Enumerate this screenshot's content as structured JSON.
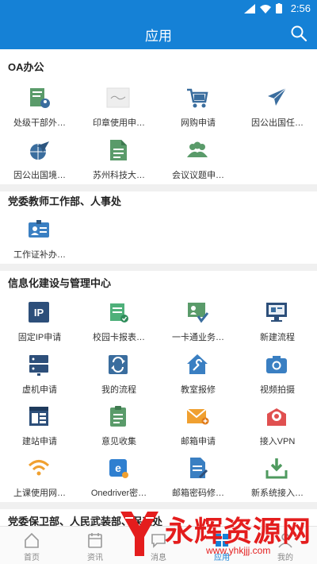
{
  "status": {
    "time": "2:56"
  },
  "header": {
    "title": "应用"
  },
  "sections": [
    {
      "title": "OA办公",
      "items": [
        {
          "label": "处级干部外…",
          "icon": "leader-leave-icon"
        },
        {
          "label": "印章使用申…",
          "icon": "seal-icon"
        },
        {
          "label": "网购申请",
          "icon": "cart-icon"
        },
        {
          "label": "因公出国任…",
          "icon": "airplane-icon"
        },
        {
          "label": "因公出国境…",
          "icon": "globe-plane-icon"
        },
        {
          "label": "苏州科技大…",
          "icon": "document-icon"
        },
        {
          "label": "会议议题申…",
          "icon": "meeting-people-icon"
        }
      ]
    },
    {
      "title": "党委教师工作部、人事处",
      "items": [
        {
          "label": "工作证补办…",
          "icon": "id-card-icon"
        }
      ]
    },
    {
      "title": "信息化建设与管理中心",
      "items": [
        {
          "label": "固定IP申请",
          "icon": "ip-icon",
          "glyph": "IP"
        },
        {
          "label": "校园卡报表…",
          "icon": "campus-card-icon"
        },
        {
          "label": "一卡通业务…",
          "icon": "card-business-icon"
        },
        {
          "label": "新建流程",
          "icon": "new-process-icon"
        },
        {
          "label": "虚机申请",
          "icon": "server-icon"
        },
        {
          "label": "我的流程",
          "icon": "my-process-icon"
        },
        {
          "label": "教室报修",
          "icon": "repair-icon"
        },
        {
          "label": "视频拍摄",
          "icon": "camera-icon"
        },
        {
          "label": "建站申请",
          "icon": "website-icon"
        },
        {
          "label": "意见收集",
          "icon": "clipboard-icon"
        },
        {
          "label": "邮箱申请",
          "icon": "mail-icon"
        },
        {
          "label": "接入VPN",
          "icon": "vpn-icon"
        },
        {
          "label": "上课使用网…",
          "icon": "wifi-icon"
        },
        {
          "label": "Onedriver密…",
          "icon": "onedrive-icon"
        },
        {
          "label": "邮箱密码修…",
          "icon": "mail-password-icon"
        },
        {
          "label": "新系统接入…",
          "icon": "download-icon"
        }
      ]
    },
    {
      "title": "党委保卫部、人民武装部、保卫处",
      "items": []
    }
  ],
  "nav": [
    {
      "label": "首页",
      "icon": "home-icon"
    },
    {
      "label": "资讯",
      "icon": "news-icon"
    },
    {
      "label": "消息",
      "icon": "message-icon"
    },
    {
      "label": "应用",
      "icon": "apps-icon"
    },
    {
      "label": "我的",
      "icon": "profile-icon"
    }
  ],
  "watermark": {
    "text": "永辉资源网",
    "url": "www.yhkjjj.com"
  },
  "colors": {
    "primary": "#1581d6",
    "iconBlue": "#3a6d9e",
    "iconGreen": "#5a9b6a",
    "iconOrange": "#f0a030"
  }
}
